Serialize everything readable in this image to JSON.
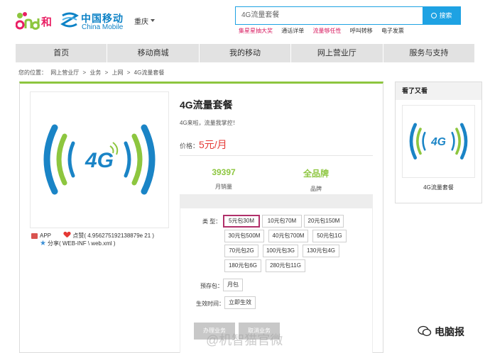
{
  "header": {
    "brand_and": "和",
    "cm_cn": "中国移动",
    "cm_en": "China Mobile",
    "city": "重庆",
    "search_value": "4G流量套餐",
    "search_button": "搜索",
    "hot_links": [
      "集星星抽大奖",
      "通话详单",
      "流量够任性",
      "呼叫转移",
      "电子发票"
    ]
  },
  "nav": [
    "首页",
    "移动商城",
    "我的移动",
    "网上营业厅",
    "服务与支持"
  ],
  "breadcrumb": [
    "您的位置：",
    "网上营业厅",
    ">",
    "业务",
    ">",
    "上网",
    ">",
    "4G流量套餐"
  ],
  "product": {
    "title": "4G流量套餐",
    "subtitle": "4G来啦，流量我掌控！",
    "price_label": "价格：",
    "price_value": "5元/月",
    "icon_text": "4G",
    "stats": [
      {
        "value": "39397",
        "label": "月销量"
      },
      {
        "value": "全品牌",
        "label": "品牌"
      }
    ],
    "meta": {
      "app": "APP",
      "likes": "点赞( 4.956275192138879e 21 )",
      "share": "分享( WEB-INF \\ web.xml )"
    }
  },
  "options": {
    "type_label": "类   型：",
    "types": [
      "5元包30M",
      "10元包70M",
      "20元包150M",
      "30元包500M",
      "40元包700M",
      "50元包1G",
      "70元包2G",
      "100元包3G",
      "130元包4G",
      "180元包6G",
      "280元包11G"
    ],
    "selected_type": "5元包30M",
    "prestore_label": "预存包：",
    "prestore_value": "月包",
    "effect_label": "生效时间：",
    "effect_value": "立即生效",
    "buttons": [
      "办理业务",
      "取消业务"
    ]
  },
  "side": {
    "title": "看了又看",
    "caption": "4G流量套餐"
  },
  "watermarks": {
    "weibo": "@机智猫官微",
    "brand": "电脑报"
  },
  "colors": {
    "brand_blue": "#1ea2e3",
    "brand_green": "#8dc63f",
    "price_red": "#e53935",
    "pink": "#d81b60"
  }
}
